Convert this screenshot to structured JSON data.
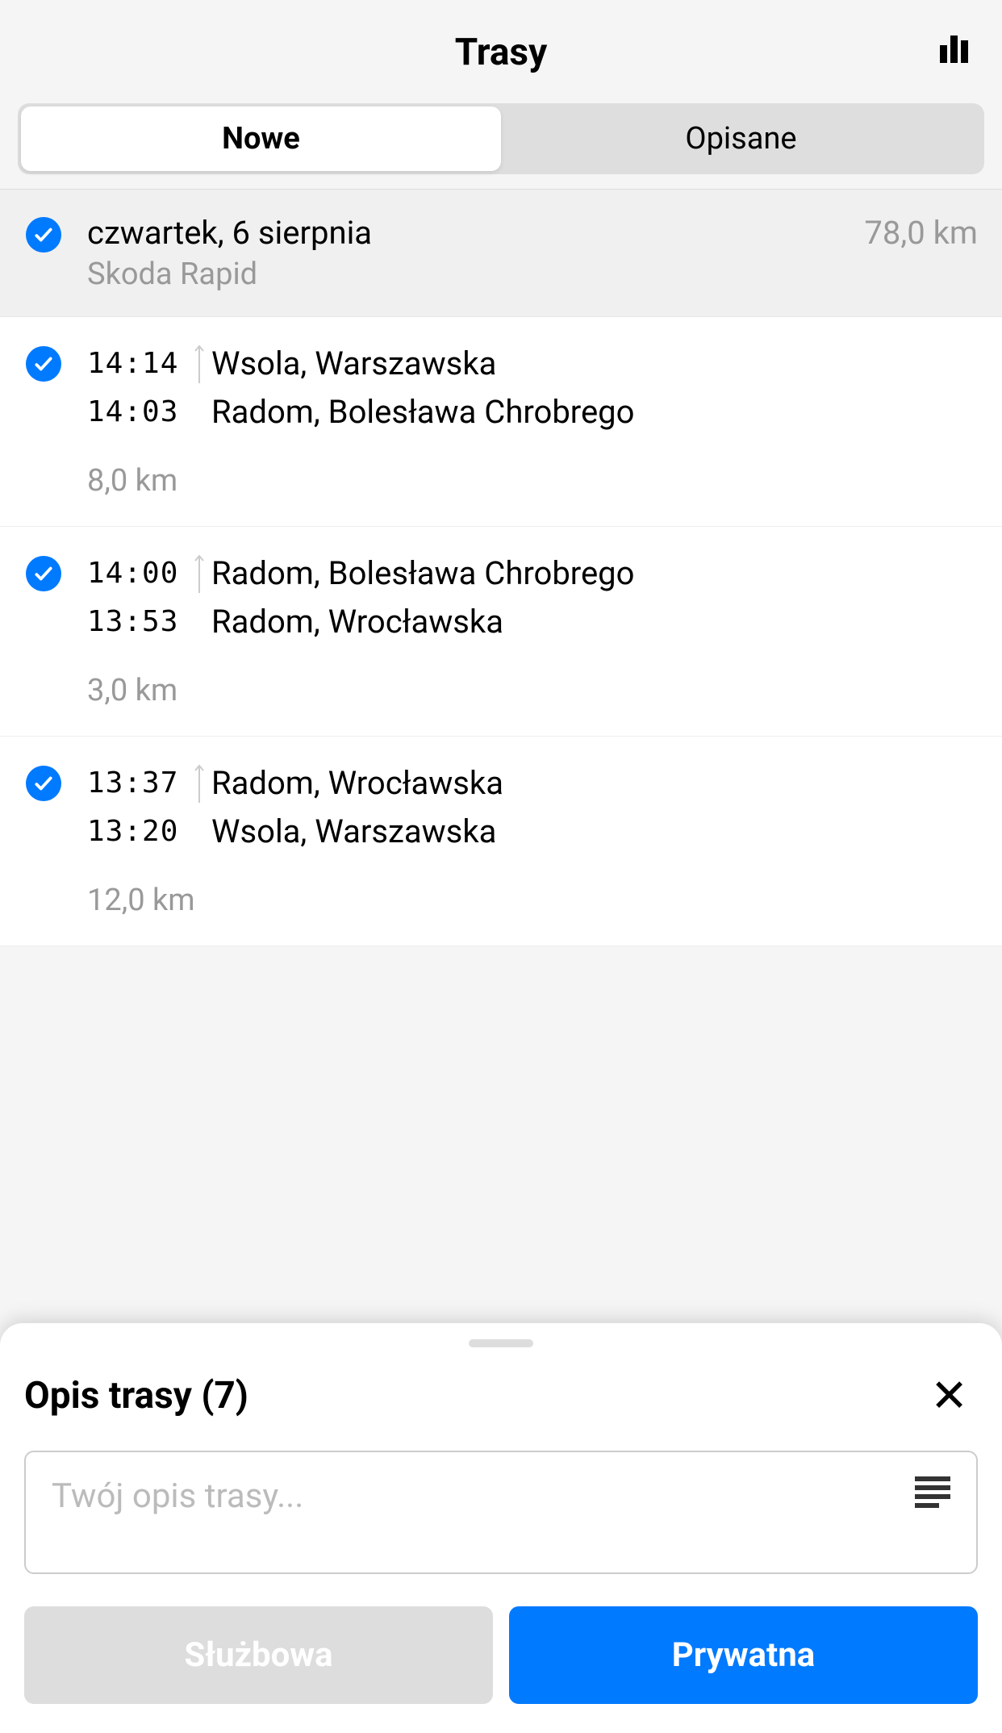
{
  "header": {
    "title": "Trasy"
  },
  "tabs": {
    "new": "Nowe",
    "described": "Opisane"
  },
  "group": {
    "date": "czwartek, 6 sierpnia",
    "vehicle": "Skoda Rapid",
    "distance": "78,0 km"
  },
  "trips": [
    {
      "time_end": "14:14",
      "place_end": "Wsola, Warszawska",
      "time_start": "14:03",
      "place_start": "Radom, Bolesława Chrobrego",
      "distance": "8,0 km"
    },
    {
      "time_end": "14:00",
      "place_end": "Radom, Bolesława Chrobrego",
      "time_start": "13:53",
      "place_start": "Radom, Wrocławska",
      "distance": "3,0 km"
    },
    {
      "time_end": "13:37",
      "place_end": "Radom, Wrocławska",
      "time_start": "13:20",
      "place_start": "Wsola, Warszawska",
      "distance": "12,0 km"
    }
  ],
  "sheet": {
    "title": "Opis trasy (7)",
    "placeholder": "Twój opis trasy...",
    "btn_business": "Służbowa",
    "btn_private": "Prywatna"
  }
}
